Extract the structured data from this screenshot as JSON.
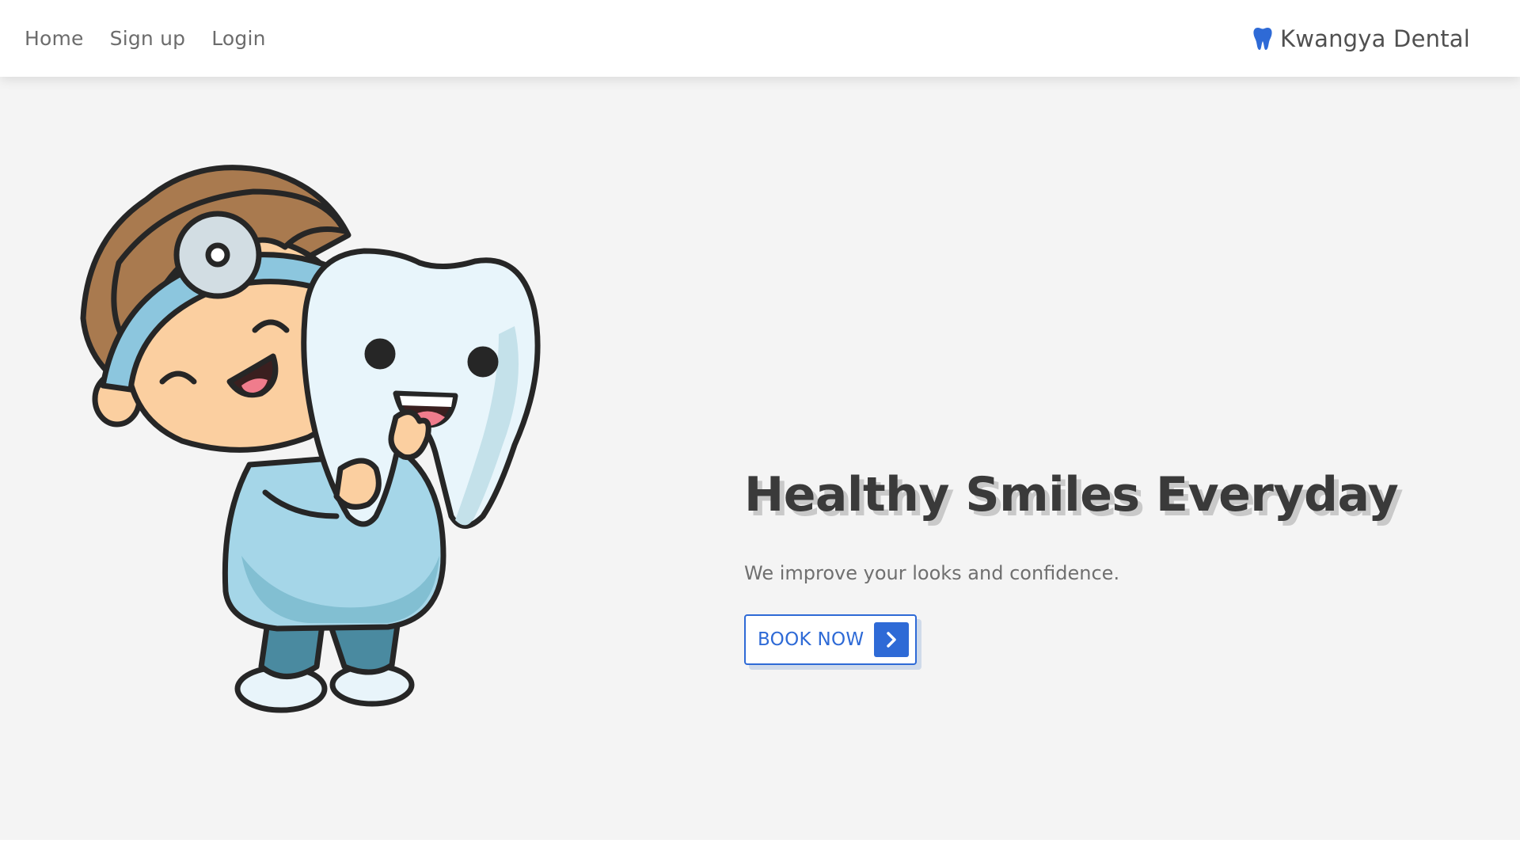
{
  "nav": {
    "links": [
      {
        "label": "Home"
      },
      {
        "label": "Sign up"
      },
      {
        "label": "Login"
      }
    ],
    "brand": {
      "name": "Kwangya Dental",
      "icon": "tooth-icon"
    }
  },
  "hero": {
    "title": "Healthy Smiles Everyday",
    "subtitle": "We improve your looks and confidence.",
    "cta": {
      "label": "BOOK NOW",
      "icon": "chevron-right-icon"
    },
    "illustration": "dentist-hugging-tooth-illustration"
  },
  "colors": {
    "accent": "#2e6ad6",
    "background": "#f4f4f4",
    "title": "#3a3a3a",
    "text": "#6f6f6f"
  }
}
